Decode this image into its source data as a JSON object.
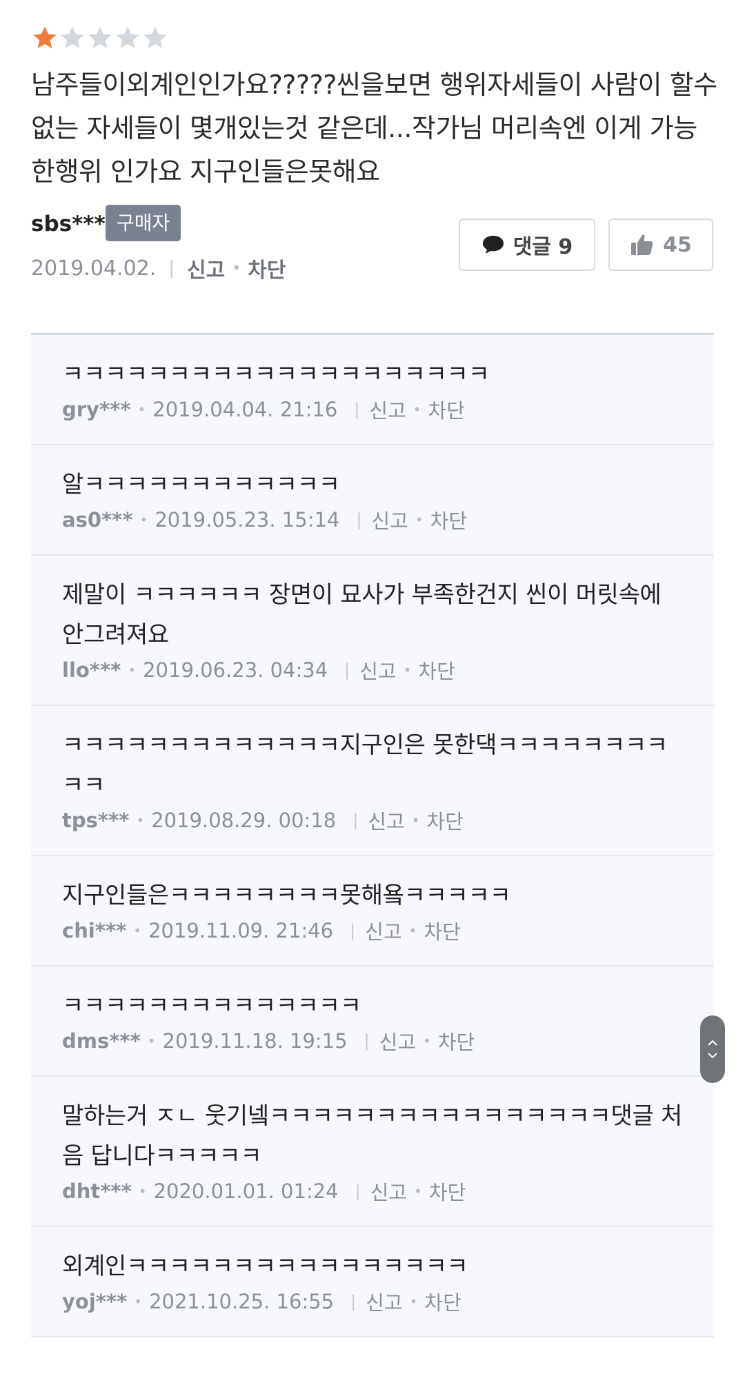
{
  "review": {
    "rating": 1,
    "rating_max": 5,
    "star_filled_color": "#ef7b3b",
    "star_empty_color": "#d3d7de",
    "text": "남주들이외계인인가요?????씬을보면 행위자세들이 사람이 할수없는 자세들이 몇개있는것 같은데...작가님 머리속엔 이게 가능한행위 인가요 지구인들은못해요",
    "author": "sbs***",
    "badge": "구매자",
    "date": "2019.04.02.",
    "report_label": "신고",
    "block_label": "차단",
    "comment_button_label": "댓글 9",
    "like_count": "45"
  },
  "comments": [
    {
      "text": "ㅋㅋㅋㅋㅋㅋㅋㅋㅋㅋㅋㅋㅋㅋㅋㅋㅋㅋㅋㅋ",
      "user": "gry***",
      "date": "2019.04.04. 21:16",
      "report": "신고",
      "block": "차단"
    },
    {
      "text": "알ㅋㅋㅋㅋㅋㅋㅋㅋㅋㅋㅋㅋ",
      "user": "as0***",
      "date": "2019.05.23. 15:14",
      "report": "신고",
      "block": "차단"
    },
    {
      "text": "제말이 ㅋㅋㅋㅋㅋㅋ 장면이 묘사가 부족한건지 씬이 머릿속에 안그려져요",
      "user": "llo***",
      "date": "2019.06.23. 04:34",
      "report": "신고",
      "block": "차단"
    },
    {
      "text": "ㅋㅋㅋㅋㅋㅋㅋㅋㅋㅋㅋㅋㅋ지구인은 못한댁ㅋㅋㅋㅋㅋㅋㅋㅋㅋㅋ",
      "user": "tps***",
      "date": "2019.08.29. 00:18",
      "report": "신고",
      "block": "차단"
    },
    {
      "text": "지구인들은ㅋㅋㅋㅋㅋㅋㅋㅋ못해욬ㅋㅋㅋㅋㅋ",
      "user": "chi***",
      "date": "2019.11.09. 21:46",
      "report": "신고",
      "block": "차단"
    },
    {
      "text": "ㅋㅋㅋㅋㅋㅋㅋㅋㅋㅋㅋㅋㅋㅋ",
      "user": "dms***",
      "date": "2019.11.18. 19:15",
      "report": "신고",
      "block": "차단"
    },
    {
      "text": "말하는거 ㅈㄴ 웃기넼ㅋㅋㅋㅋㅋㅋㅋㅋㅋㅋㅋㅋㅋㅋㅋㅋ댓글 처음 답니다ㅋㅋㅋㅋㅋ",
      "user": "dht***",
      "date": "2020.01.01. 01:24",
      "report": "신고",
      "block": "차단"
    },
    {
      "text": "외계인ㅋㅋㅋㅋㅋㅋㅋㅋㅋㅋㅋㅋㅋㅋㅋㅋ",
      "user": "yoj***",
      "date": "2021.10.25. 16:55",
      "report": "신고",
      "block": "차단"
    }
  ]
}
